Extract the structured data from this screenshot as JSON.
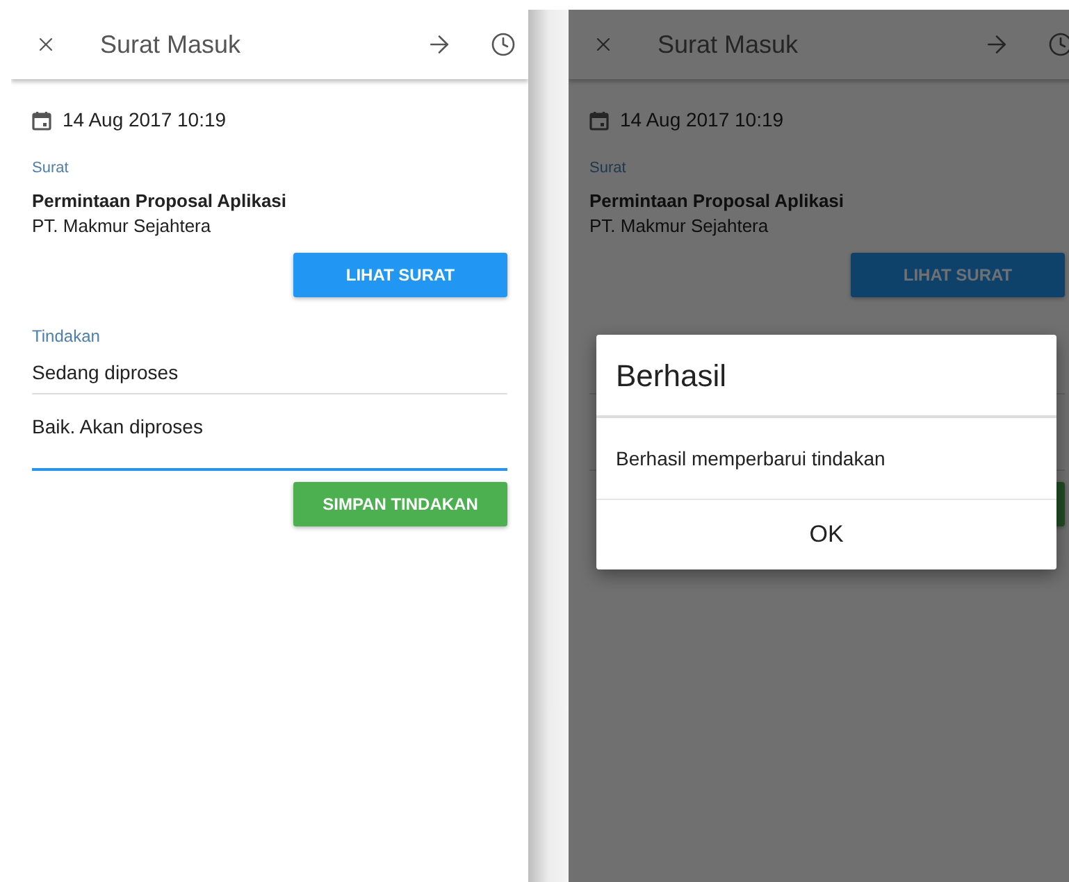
{
  "screens": [
    {
      "title": "Surat Masuk",
      "date": "14 Aug 2017 10:19",
      "letter_label": "Surat",
      "subject": "Permintaan Proposal Aplikasi",
      "sender": "PT. Makmur Sejahtera",
      "view_button": "LIHAT SURAT",
      "action_label": "Tindakan",
      "status_field": {
        "value": "Sedang diproses"
      },
      "note_field": {
        "value": "Baik. Akan diproses",
        "focused": true
      },
      "save_button": "SIMPAN TINDAKAN",
      "dimmed": false
    },
    {
      "title": "Surat Masuk",
      "date": "14 Aug 2017 10:19",
      "letter_label": "Surat",
      "subject": "Permintaan Proposal Aplikasi",
      "sender": "PT. Makmur Sejahtera",
      "view_button": "LIHAT SURAT",
      "dimmed": true,
      "dialog": {
        "title": "Berhasil",
        "message": "Berhasil memperbarui tindakan",
        "button": "OK"
      }
    }
  ]
}
